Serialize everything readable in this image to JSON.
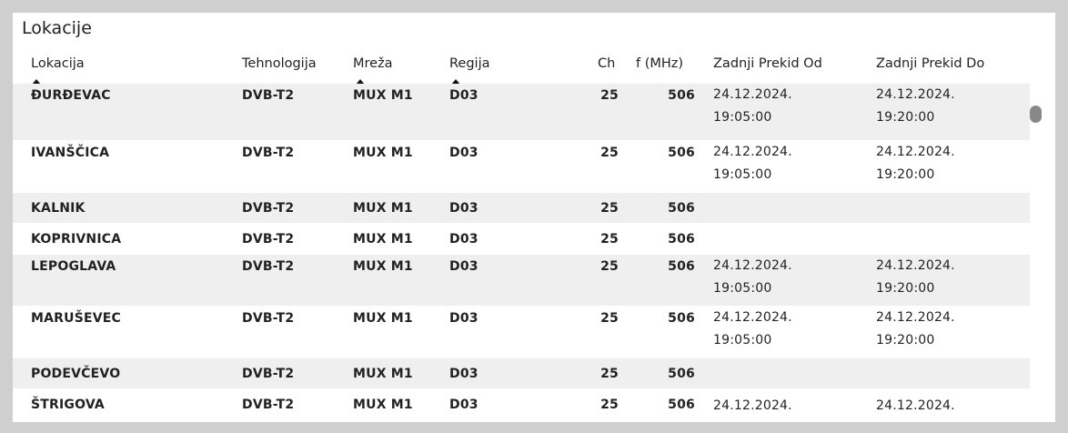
{
  "panel": {
    "title": "Lokacije"
  },
  "table": {
    "columns": [
      {
        "key": "lokacija",
        "label": "Lokacija",
        "sorted": true
      },
      {
        "key": "tehnologija",
        "label": "Tehnologija",
        "sorted": false
      },
      {
        "key": "mreza",
        "label": "Mreža",
        "sorted": true
      },
      {
        "key": "regija",
        "label": "Regija",
        "sorted": true
      },
      {
        "key": "ch",
        "label": "Ch",
        "sorted": false
      },
      {
        "key": "f",
        "label": "f (MHz)",
        "sorted": false
      },
      {
        "key": "od",
        "label": "Zadnji Prekid Od",
        "sorted": false
      },
      {
        "key": "do",
        "label": "Zadnji Prekid Do",
        "sorted": false
      }
    ],
    "rows": [
      {
        "lokacija": "ĐURĐEVAC",
        "tehnologija": "DVB-T2",
        "mreza": "MUX M1",
        "regija": "D03",
        "ch": "25",
        "f": "506",
        "od_date": "24.12.2024.",
        "od_time": "19:05:00",
        "do_date": "24.12.2024.",
        "do_time": "19:20:00"
      },
      {
        "lokacija": "IVANŠČICA",
        "tehnologija": "DVB-T2",
        "mreza": "MUX M1",
        "regija": "D03",
        "ch": "25",
        "f": "506",
        "od_date": "24.12.2024.",
        "od_time": "19:05:00",
        "do_date": "24.12.2024.",
        "do_time": "19:20:00"
      },
      {
        "lokacija": "KALNIK",
        "tehnologija": "DVB-T2",
        "mreza": "MUX M1",
        "regija": "D03",
        "ch": "25",
        "f": "506",
        "od_date": "",
        "od_time": "",
        "do_date": "",
        "do_time": ""
      },
      {
        "lokacija": "KOPRIVNICA",
        "tehnologija": "DVB-T2",
        "mreza": "MUX M1",
        "regija": "D03",
        "ch": "25",
        "f": "506",
        "od_date": "",
        "od_time": "",
        "do_date": "",
        "do_time": ""
      },
      {
        "lokacija": "LEPOGLAVA",
        "tehnologija": "DVB-T2",
        "mreza": "MUX M1",
        "regija": "D03",
        "ch": "25",
        "f": "506",
        "od_date": "24.12.2024.",
        "od_time": "19:05:00",
        "do_date": "24.12.2024.",
        "do_time": "19:20:00"
      },
      {
        "lokacija": "MARUŠEVEC",
        "tehnologija": "DVB-T2",
        "mreza": "MUX M1",
        "regija": "D03",
        "ch": "25",
        "f": "506",
        "od_date": "24.12.2024.",
        "od_time": "19:05:00",
        "do_date": "24.12.2024.",
        "do_time": "19:20:00"
      },
      {
        "lokacija": "PODEVČEVO",
        "tehnologija": "DVB-T2",
        "mreza": "MUX M1",
        "regija": "D03",
        "ch": "25",
        "f": "506",
        "od_date": "",
        "od_time": "",
        "do_date": "",
        "do_time": ""
      },
      {
        "lokacija": "ŠTRIGOVA",
        "tehnologija": "DVB-T2",
        "mreza": "MUX M1",
        "regija": "D03",
        "ch": "25",
        "f": "506",
        "od_date": "24.12.2024.",
        "od_time": "",
        "do_date": "24.12.2024.",
        "do_time": ""
      }
    ]
  },
  "colors": {
    "accent": "#3a96dd",
    "row_alt": "#efefef",
    "scroll_thumb": "#888888"
  }
}
